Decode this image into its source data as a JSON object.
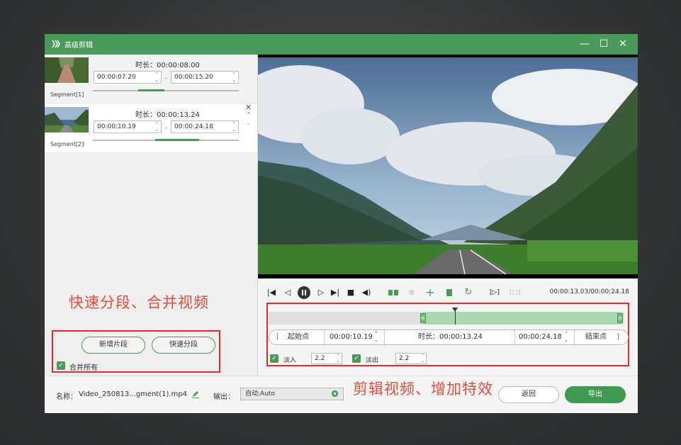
{
  "window": {
    "title": "高级剪辑",
    "minimize_glyph": "—",
    "maximize_glyph": "☐",
    "close_glyph": "✕"
  },
  "segments": [
    {
      "name": "Segment[1]",
      "duration_label": "时长：00:00:08.00",
      "start": "00:00:07.20",
      "end": "00:00:15.20",
      "progress_fraction": 0.33
    },
    {
      "name": "Segment[2]",
      "duration_label": "时长：00:00:13.24",
      "start": "00:00:10.19",
      "end": "00:00:24.18",
      "progress_fraction": 0.55
    }
  ],
  "annotations": {
    "left": "快速分段、合并视频",
    "right": "剪辑视频、增加特效"
  },
  "buttons": {
    "add_segment": "新增片段",
    "quick_split": "快速分段",
    "back": "返回",
    "export": "导出"
  },
  "merge_all": {
    "label": "合并所有",
    "checked": true
  },
  "player": {
    "time": "00:00:13.03/00:00:24.18"
  },
  "clip": {
    "start_label": "起始点",
    "start": "00:00:10.19",
    "duration_label": "时长：00:00:13.24",
    "end": "00:00:24.18",
    "end_label": "结束点"
  },
  "fade": {
    "in_label": "淡入",
    "in_value": "2.2",
    "out_label": "淡出",
    "out_value": "2.2"
  },
  "footer": {
    "name_label": "名称：",
    "name_value": "Video_250813...gment(1).mp4",
    "output_label": "输出：",
    "output_value": "自动;Auto"
  },
  "colors": {
    "accent": "#4a9a5b",
    "annotation": "#e94b3c",
    "highlight_border": "#e42a2a"
  },
  "icons": [
    "edit-icon",
    "gear-icon",
    "close-icon",
    "chevron-up-icon",
    "chevron-down-icon"
  ]
}
